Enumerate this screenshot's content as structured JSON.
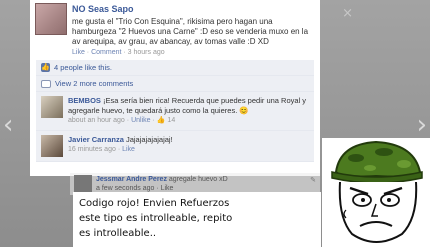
{
  "post": {
    "author": "NO Seas Sapo",
    "text": "me gusta el \"Trio Con Esquina\", rikisima pero hagan una hamburgeza \"2 Huevos una Carne\" :D eso se venderia muxo en la av arequipa, av grau, av abancay, av tomas valle :D XD",
    "like_link": "Like",
    "comment_link": "Comment",
    "time": "3 hours ago"
  },
  "ufi": {
    "likes_text": "4 people like this.",
    "view_comments": "View 2 more comments"
  },
  "comments": [
    {
      "author": "BEMBOS",
      "text": "¡Esa sería bien rica! Recuerda que puedes pedir una Royal y agregarle huevo, te quedará justo como la quieres. 😊",
      "time": "about an hour ago",
      "unlike_link": "Unlike",
      "like_count": "14"
    },
    {
      "author": "Javier Carranza",
      "text": "Jajajajajajajaj!",
      "time": "16 minutes ago",
      "like_link": "Like"
    }
  ],
  "ghost_comment": {
    "author": "Jessmar Andre Perez",
    "text": "agregale huevo xD",
    "time": "a few seconds ago",
    "like_link": "Like"
  },
  "caption": {
    "line1": "Codigo rojo! Envien Refuerzos",
    "line2": "este tipo es introlleable, repito",
    "line3": "es introlleable.."
  },
  "controls": {
    "prev_arrow": "‹",
    "next_arrow": "›",
    "close_glyph": "×"
  }
}
